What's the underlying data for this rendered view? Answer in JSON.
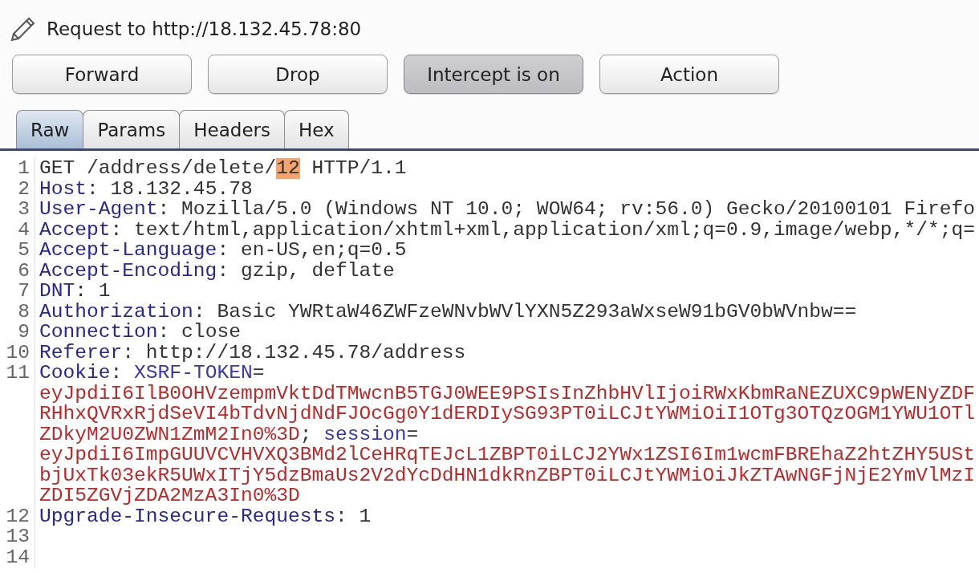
{
  "title": "Request to http://18.132.45.78:80",
  "buttons": [
    {
      "label": "Forward",
      "pressed": false
    },
    {
      "label": "Drop",
      "pressed": false
    },
    {
      "label": "Intercept is on",
      "pressed": true
    },
    {
      "label": "Action",
      "pressed": false
    }
  ],
  "tabs": [
    {
      "label": "Raw",
      "selected": true
    },
    {
      "label": "Params",
      "selected": false
    },
    {
      "label": "Headers",
      "selected": false
    },
    {
      "label": "Hex",
      "selected": false
    }
  ],
  "lines": [
    {
      "number": "1",
      "rows": [
        {
          "segments": [
            {
              "kind": "plain",
              "text": "GET /address/delete/"
            },
            {
              "kind": "highlight",
              "text": "12"
            },
            {
              "kind": "plain",
              "text": " HTTP/1.1"
            }
          ]
        }
      ]
    },
    {
      "number": "2",
      "rows": [
        {
          "segments": [
            {
              "kind": "name",
              "text": "Host"
            },
            {
              "kind": "plain",
              "text": ": 18.132.45.78"
            }
          ]
        }
      ]
    },
    {
      "number": "3",
      "rows": [
        {
          "segments": [
            {
              "kind": "name",
              "text": "User-Agent"
            },
            {
              "kind": "plain",
              "text": ": Mozilla/5.0 (Windows NT 10.0; WOW64; rv:56.0) Gecko/20100101 Firefo"
            }
          ]
        }
      ]
    },
    {
      "number": "4",
      "rows": [
        {
          "segments": [
            {
              "kind": "name",
              "text": "Accept"
            },
            {
              "kind": "plain",
              "text": ": text/html,application/xhtml+xml,application/xml;q=0.9,image/webp,*/*;q="
            }
          ]
        }
      ]
    },
    {
      "number": "5",
      "rows": [
        {
          "segments": [
            {
              "kind": "name",
              "text": "Accept-Language"
            },
            {
              "kind": "plain",
              "text": ": en-US,en;q=0.5"
            }
          ]
        }
      ]
    },
    {
      "number": "6",
      "rows": [
        {
          "segments": [
            {
              "kind": "name",
              "text": "Accept-Encoding"
            },
            {
              "kind": "plain",
              "text": ": gzip, deflate"
            }
          ]
        }
      ]
    },
    {
      "number": "7",
      "rows": [
        {
          "segments": [
            {
              "kind": "name",
              "text": "DNT"
            },
            {
              "kind": "plain",
              "text": ": 1"
            }
          ]
        }
      ]
    },
    {
      "number": "8",
      "rows": [
        {
          "segments": [
            {
              "kind": "name",
              "text": "Authorization"
            },
            {
              "kind": "plain",
              "text": ": Basic YWRtaW46ZWFzeWNvbWVlYXN5Z293aWxseW91bGV0bWVnbw=="
            }
          ]
        }
      ]
    },
    {
      "number": "9",
      "rows": [
        {
          "segments": [
            {
              "kind": "name",
              "text": "Connection"
            },
            {
              "kind": "plain",
              "text": ": close"
            }
          ]
        }
      ]
    },
    {
      "number": "10",
      "rows": [
        {
          "segments": [
            {
              "kind": "name",
              "text": "Referer"
            },
            {
              "kind": "plain",
              "text": ": http://18.132.45.78/address"
            }
          ]
        }
      ]
    },
    {
      "number": "11",
      "rows": [
        {
          "segments": [
            {
              "kind": "name",
              "text": "Cookie"
            },
            {
              "kind": "plain",
              "text": ": "
            },
            {
              "kind": "param",
              "text": "XSRF-TOKEN"
            },
            {
              "kind": "plain",
              "text": "="
            }
          ]
        },
        {
          "segments": [
            {
              "kind": "value",
              "text": "eyJpdiI6IlB0OHVzempmVktDdTMwcnB5TGJ0WEE9PSIsInZhbHVlIjoiRWxKbmRaNEZUXC9pWENyZDF"
            }
          ]
        },
        {
          "segments": [
            {
              "kind": "value",
              "text": "RHhxQVRxRjdSeVI4bTdvNjdNdFJOcGg0Y1dERDIySG93PT0iLCJtYWMiOiI1OTg3OTQzOGM1YWU1OTl"
            }
          ]
        },
        {
          "segments": [
            {
              "kind": "value",
              "text": "ZDkyM2U0ZWN1ZmM2In0%3D"
            },
            {
              "kind": "plain",
              "text": "; "
            },
            {
              "kind": "param",
              "text": "session"
            },
            {
              "kind": "plain",
              "text": "="
            }
          ]
        },
        {
          "segments": [
            {
              "kind": "value",
              "text": "eyJpdiI6ImpGUUVCVHVXQ3BMd2lCeHRqTEJcL1ZBPT0iLCJ2YWx1ZSI6Im1wcmFBREhaZ2htZHY5USt"
            }
          ]
        },
        {
          "segments": [
            {
              "kind": "value",
              "text": "bjUxTk03ekR5UWxITjY5dzBmaUs2V2dYcDdHN1dkRnZBPT0iLCJtYWMiOiJkZTAwNGFjNjE2YmVlMzI"
            }
          ]
        },
        {
          "segments": [
            {
              "kind": "value",
              "text": "ZDI5ZGVjZDA2MzA3In0%3D"
            }
          ]
        }
      ]
    },
    {
      "number": "12",
      "rows": [
        {
          "segments": [
            {
              "kind": "name",
              "text": "Upgrade-Insecure-Requests"
            },
            {
              "kind": "plain",
              "text": ": 1"
            }
          ]
        }
      ]
    },
    {
      "number": "13"
    },
    {
      "number": "14"
    }
  ]
}
